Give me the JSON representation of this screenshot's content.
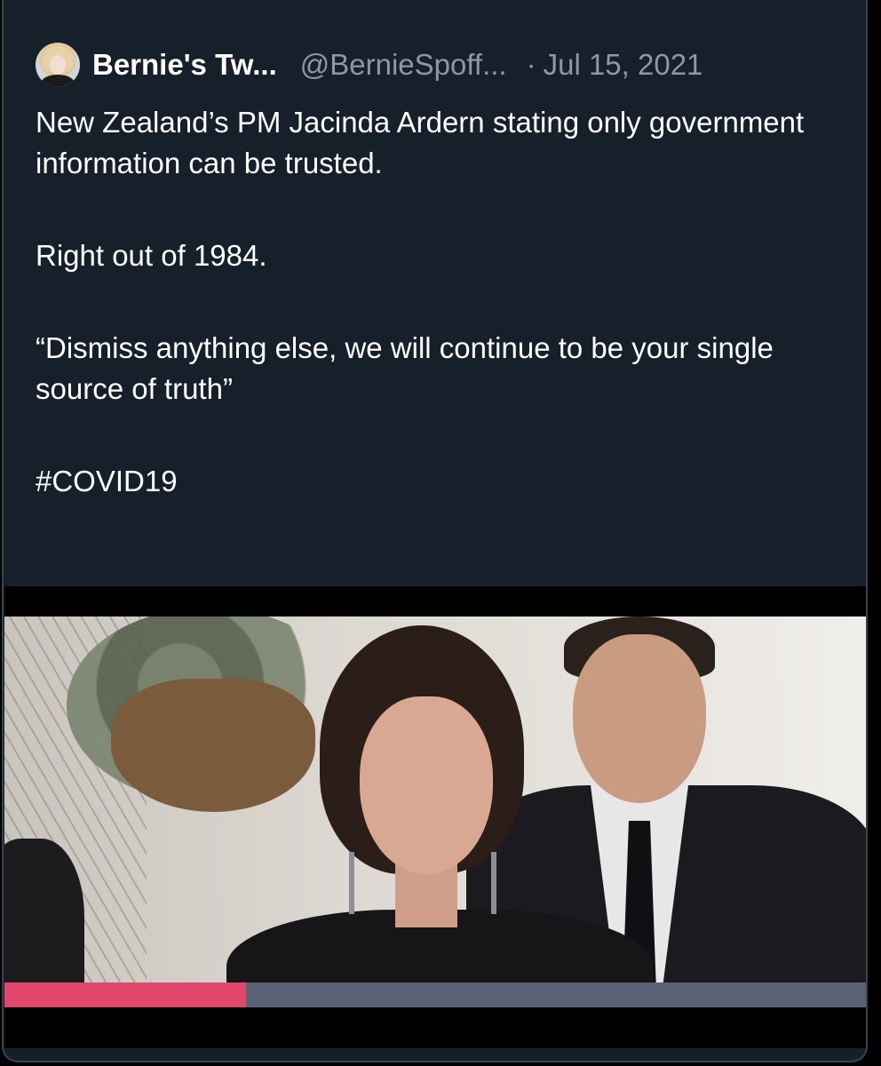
{
  "tweet": {
    "author": {
      "display_name": "Bernie's Tw...",
      "handle": "@BernieSpoff...",
      "avatar": "profile-photo"
    },
    "separator": "·",
    "date": "Jul 15, 2021",
    "text": {
      "line1": "New Zealand’s PM Jacinda Ardern stating only government information can be trusted.",
      "line2": "Right out of 1984.",
      "line3": "“Dismiss anything else, we will continue to be your single source of truth”",
      "hashtag": "#COVID19"
    },
    "media": {
      "type": "video",
      "progress_fraction": 0.28,
      "progress_color": "#e0476b",
      "track_color": "#5a6375"
    }
  },
  "theme": {
    "background": "#15202b",
    "border": "#38444d",
    "text_primary": "#ffffff",
    "text_secondary": "#8b98a5"
  }
}
